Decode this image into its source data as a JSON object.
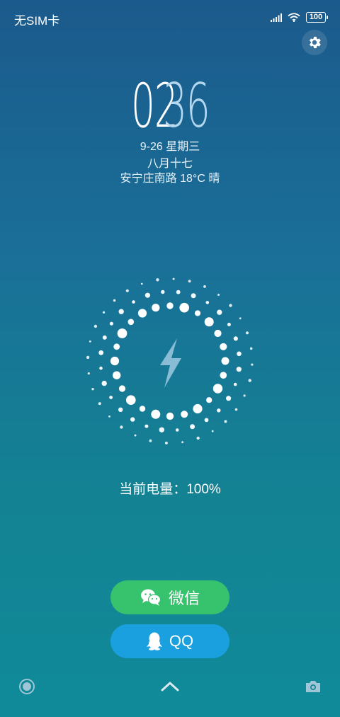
{
  "status": {
    "carrier": "无SIM卡",
    "battery": "100"
  },
  "clock": {
    "hours": "02",
    "minutes": "36"
  },
  "date": {
    "line": "9-26  星期三",
    "lunar": "八月十七",
    "weather": "安宁庄南路 18°C 晴"
  },
  "charging": {
    "label": "当前电量：100%"
  },
  "apps": {
    "wechat": "微信",
    "qq": "QQ"
  },
  "colors": {
    "wechat": "#37c26e",
    "qq": "#1aa0de",
    "minutes": "#b3d7ee"
  }
}
